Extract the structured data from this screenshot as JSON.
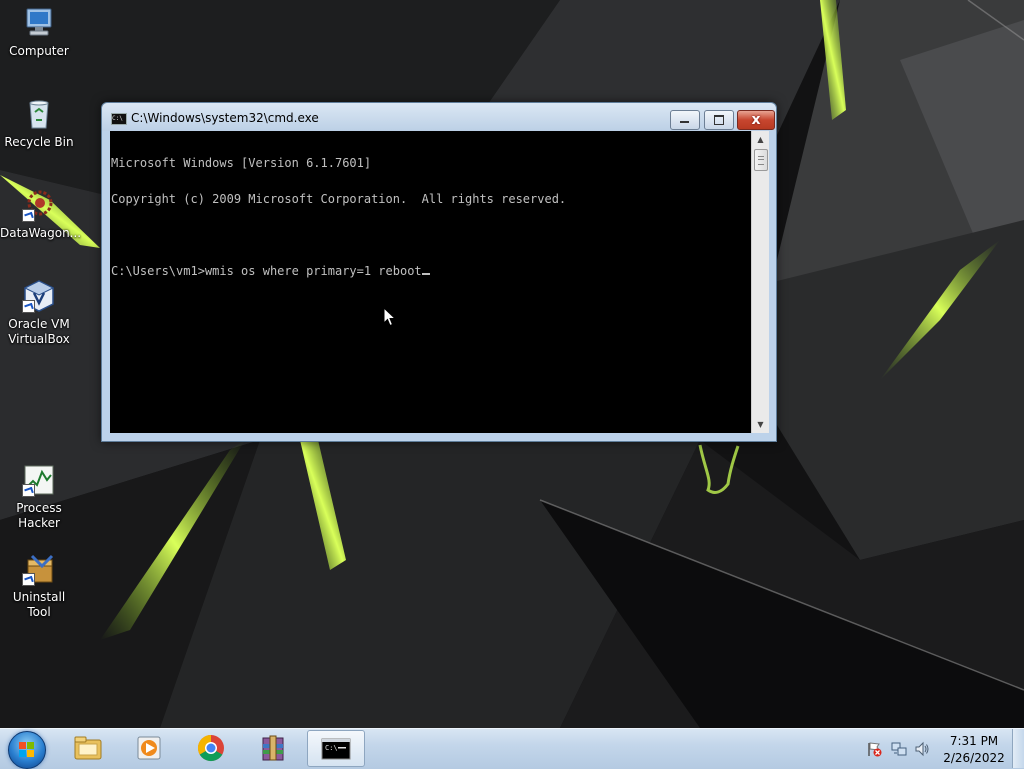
{
  "desktop": {
    "icons": [
      {
        "label": "Computer",
        "icon": "computer-icon"
      },
      {
        "label": "Recycle Bin",
        "icon": "recycle-bin-icon"
      },
      {
        "label": "DataWagon...",
        "icon": "datawagon-icon"
      },
      {
        "label_line1": "Oracle VM",
        "label_line2": "VirtualBox",
        "icon": "virtualbox-icon"
      },
      {
        "label_line1": "Process",
        "label_line2": "Hacker",
        "icon": "process-hacker-icon"
      },
      {
        "label": "Uninstall Tool",
        "icon": "uninstall-tool-icon"
      }
    ]
  },
  "cmd_window": {
    "title": "C:\\Windows\\system32\\cmd.exe",
    "title_icon_text": "C:\\",
    "close_label": "x",
    "lines": [
      "Microsoft Windows [Version 6.1.7601]",
      "Copyright (c) 2009 Microsoft Corporation.  All rights reserved.",
      "",
      "C:\\Users\\vm1>wmis os where primary=1 reboot"
    ],
    "colors": {
      "background": "#000000",
      "text": "#c0c0c0"
    }
  },
  "taskbar": {
    "pinned": [
      {
        "name": "windows-explorer",
        "icon": "folder-icon"
      },
      {
        "name": "media-player",
        "icon": "media-player-icon"
      },
      {
        "name": "google-chrome",
        "icon": "chrome-icon"
      },
      {
        "name": "winrar",
        "icon": "winrar-icon"
      },
      {
        "name": "command-prompt",
        "icon": "cmd-icon",
        "active": true
      }
    ],
    "tray": {
      "icons": [
        "action-center-flag-icon",
        "network-icon",
        "volume-icon"
      ],
      "time": "7:31 PM",
      "date": "2/26/2022"
    }
  }
}
